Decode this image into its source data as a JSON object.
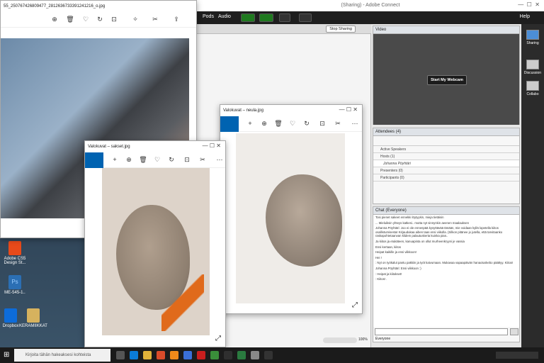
{
  "main_photo": {
    "title": "55_250767426809477_2812636733391241216_o.jpg"
  },
  "desktop_icons": [
    {
      "label": "Adobe CS5 Design St...",
      "color": "#e84a1a"
    },
    {
      "label": "ME-545-1..",
      "color": "#2b6fb4"
    },
    {
      "label": "Dropbox",
      "color": "#0d6cd9"
    },
    {
      "label": "KERAMIIKKAT",
      "color": "#d6b25e"
    }
  ],
  "adobe_connect": {
    "window_title": "(Sharing) - Adobe Connect",
    "menu": [
      "Pods",
      "Audio"
    ],
    "help": "Help",
    "stop_sharing": "Stop Sharing",
    "video_pod": {
      "title": "Video",
      "webcam_button": "Start My Webcam"
    },
    "attendees_pod": {
      "title": "Attendees",
      "count": "(4)",
      "active_speakers": "Active Speakers",
      "hosts": "Hosts (1)",
      "host_name": "Johanna Pöyhtäri",
      "presenters": "Presenters (0)",
      "participants": "Participants (0)"
    },
    "chat_pod": {
      "title": "Chat",
      "scope": "(Everyone)",
      "messages": [
        "Tosi pienet sakeet ennekki löytyykin, mieja tietäisin",
        "... Mieluiksin yhteys katkesi.. mutta nyt sinnynkin aeenen maalauksen",
        "Johanna Pöyhtäri: Joo ei ole ennenpää kysyttävää tänään, mie voidaan kyllä lopetella kiitos osallistumisesta! Kirjaudukaa aiben taas ensi viikolla. (Silkon pitänee jo jutella, että tarvitaanko raskapohtetaanvan klidem palautuskerta kuinka pian..",
        "Ja kiitos ja etukäteen, kanuapinta on ollut murheenkryyni je vassia",
        "Ensi kertaan, kiitos",
        "Heipat kaikille ja ensi viikkoon!",
        "Hei !",
        ": Nyt on työkalut pantu pakkiin ja työt kaivumaan. Mukavaa vapaapäivän hanaotuskebo päättyy. Kiitos!",
        "Johanna Pöyhtäri: Ensi viikkoon :)",
        ": Heipat ja kiitokset!",
        ": Kiitos! ."
      ],
      "footer": "Everyone"
    },
    "rail": [
      "Sharing",
      "Discussion",
      "Collabo"
    ],
    "zoom": "100%"
  },
  "neula_window": {
    "title": "Valokuvat – neula.jpg"
  },
  "saksetwin": {
    "title": "Valokuvat – sakset.jpg"
  },
  "taskbar": {
    "search_placeholder": "Kirjoita tähän hakeaksesi kohteista"
  }
}
